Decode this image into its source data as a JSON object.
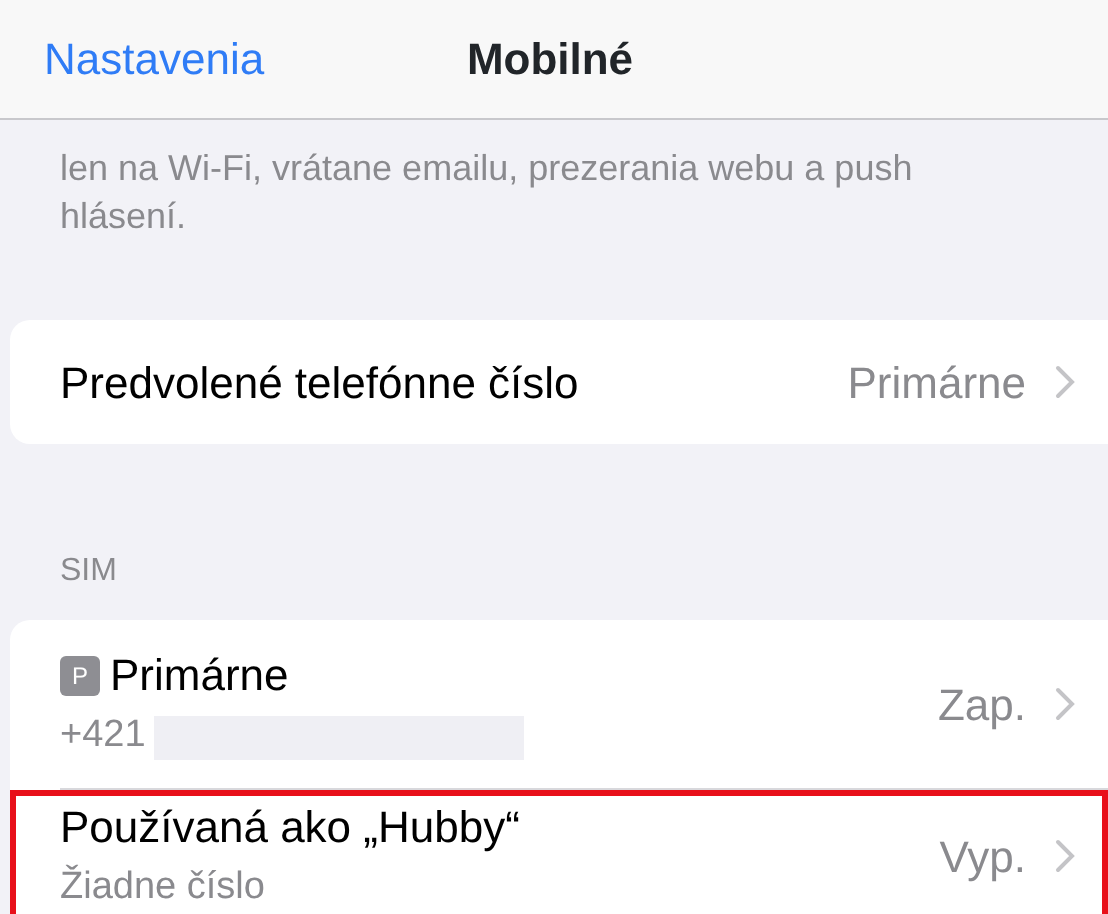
{
  "nav": {
    "back": "Nastavenia",
    "title": "Mobilné"
  },
  "footer_note": "len na Wi-Fi, vrátane emailu, prezerania webu a push hlásení.",
  "default_number": {
    "label": "Predvolené telefónne číslo",
    "value": "Primárne"
  },
  "sim_section": {
    "header": "SIM",
    "items": [
      {
        "badge": "P",
        "title": "Primárne",
        "subtitle": "+421",
        "redacted": true,
        "value": "Zap.",
        "highlighted": false
      },
      {
        "title": "Používaná ako „Hubby“",
        "subtitle": "Žiadne číslo",
        "redacted": false,
        "value": "Vyp.",
        "highlighted": true
      }
    ]
  }
}
